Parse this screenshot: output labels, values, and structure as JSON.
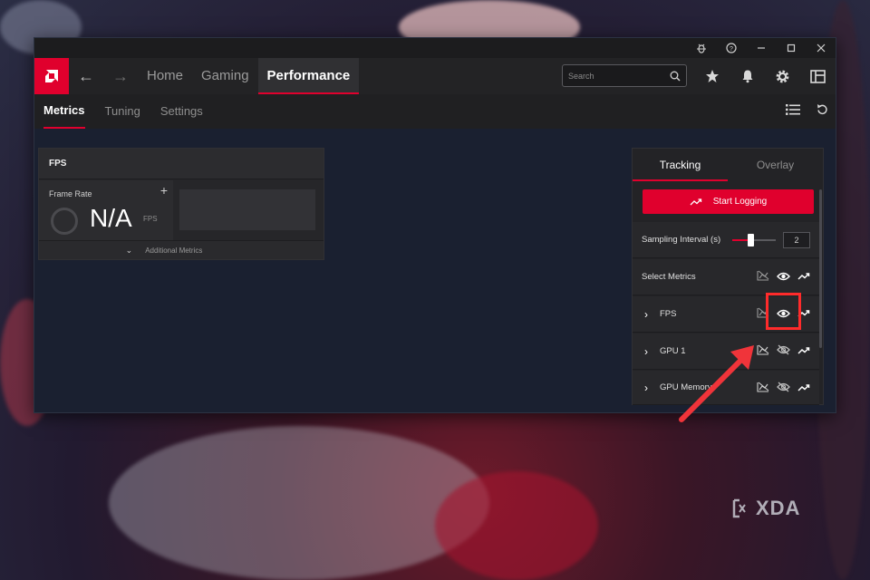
{
  "titlebar": {
    "icons": [
      "bug-icon",
      "help-icon",
      "minimize-icon",
      "maximize-icon",
      "close-icon"
    ]
  },
  "navbar": {
    "tabs": [
      {
        "label": "Home",
        "active": false
      },
      {
        "label": "Gaming",
        "active": false
      },
      {
        "label": "Performance",
        "active": true
      }
    ],
    "search": {
      "placeholder": "Search"
    },
    "icons": [
      "star-icon",
      "bell-icon",
      "gear-icon",
      "layout-icon"
    ]
  },
  "subnav": {
    "tabs": [
      {
        "label": "Metrics",
        "active": true
      },
      {
        "label": "Tuning",
        "active": false
      },
      {
        "label": "Settings",
        "active": false
      }
    ]
  },
  "fps_card": {
    "title": "FPS",
    "tile_label": "Frame Rate",
    "value": "N/A",
    "unit": "FPS",
    "additional": "Additional Metrics"
  },
  "tracking": {
    "tabs": [
      {
        "label": "Tracking",
        "active": true
      },
      {
        "label": "Overlay",
        "active": false
      }
    ],
    "start_logging": "Start Logging",
    "sampling_label": "Sampling Interval (s)",
    "sampling_value": "2",
    "sampling_level": 0.42,
    "select_metrics": "Select Metrics",
    "metrics": [
      {
        "label": "FPS",
        "visible": true
      },
      {
        "label": "GPU 1",
        "visible": false
      },
      {
        "label": "GPU Memory",
        "visible": false
      }
    ]
  },
  "watermark": {
    "text": "XDA"
  },
  "colors": {
    "accent": "#e0002d",
    "annotation": "#ff2b2b"
  }
}
